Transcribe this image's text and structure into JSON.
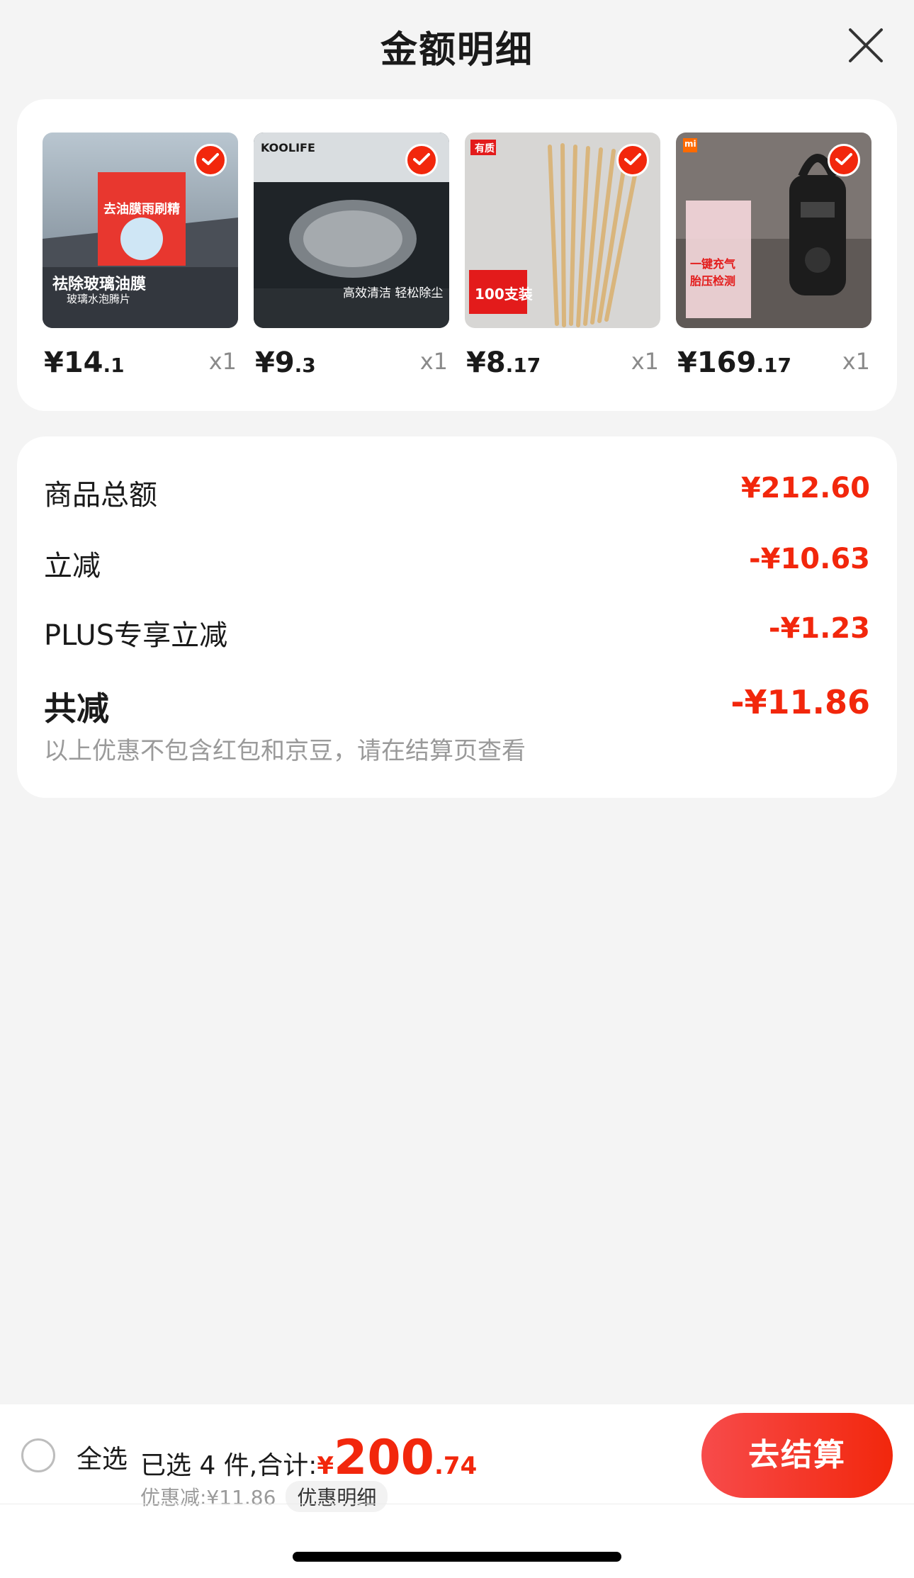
{
  "header": {
    "title": "金额明细"
  },
  "products": [
    {
      "price_int": "¥14",
      "price_dec": ".1",
      "qty": "x1",
      "image_text": "祛除玻璃油膜",
      "image_sub": "玻璃水泡腾片"
    },
    {
      "price_int": "¥9",
      "price_dec": ".3",
      "qty": "x1",
      "image_text": "高效清洁 轻松除尘",
      "image_brand": "KOOLIFE"
    },
    {
      "price_int": "¥8",
      "price_dec": ".17",
      "qty": "x1",
      "image_text": "100支装",
      "image_tag": "有质"
    },
    {
      "price_int": "¥169",
      "price_dec": ".17",
      "qty": "x1",
      "image_text": "一键充气 胎压检测",
      "image_tag": "mi"
    }
  ],
  "summary": {
    "rows": [
      {
        "label": "商品总额",
        "value": "¥212.60"
      },
      {
        "label": "立减",
        "value": "-¥10.63"
      },
      {
        "label": "PLUS专享立减",
        "value": "-¥1.23"
      }
    ],
    "total_label": "共减",
    "total_value": "-¥11.86",
    "note": "以上优惠不包含红包和京豆，请在结算页查看"
  },
  "bottom": {
    "select_all": "全选",
    "selected_text": "已选 4 件,合计:",
    "total_cur": "¥",
    "total_int": "200",
    "total_dec": ".74",
    "saved": "优惠减:¥11.86",
    "detail_btn": "优惠明细",
    "checkout": "去结算"
  },
  "colors": {
    "accent": "#f2270c",
    "background": "#f4f4f4",
    "card": "#ffffff"
  }
}
